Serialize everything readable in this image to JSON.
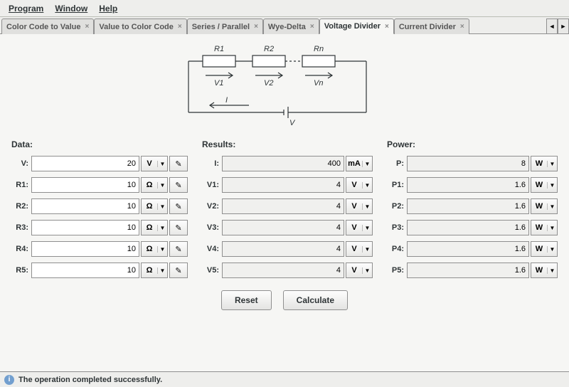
{
  "menu": {
    "program": "Program",
    "window": "Window",
    "help": "Help"
  },
  "tabs": {
    "items": [
      {
        "label": "Color Code to Value"
      },
      {
        "label": "Value to Color Code"
      },
      {
        "label": "Series / Parallel"
      },
      {
        "label": "Wye-Delta"
      },
      {
        "label": "Voltage Divider"
      },
      {
        "label": "Current Divider"
      }
    ],
    "activeIndex": 4
  },
  "diagram": {
    "r1": "R1",
    "r2": "R2",
    "rn": "Rn",
    "v1": "V1",
    "v2": "V2",
    "vn": "Vn",
    "i": "I",
    "v": "V"
  },
  "headers": {
    "data": "Data:",
    "results": "Results:",
    "power": "Power:"
  },
  "data": {
    "rows": [
      {
        "label": "V:",
        "value": "20",
        "unit": "V"
      },
      {
        "label": "R1:",
        "value": "10",
        "unit": "Ω"
      },
      {
        "label": "R2:",
        "value": "10",
        "unit": "Ω"
      },
      {
        "label": "R3:",
        "value": "10",
        "unit": "Ω"
      },
      {
        "label": "R4:",
        "value": "10",
        "unit": "Ω"
      },
      {
        "label": "R5:",
        "value": "10",
        "unit": "Ω"
      }
    ]
  },
  "results": {
    "rows": [
      {
        "label": "I:",
        "value": "400",
        "unit": "mA"
      },
      {
        "label": "V1:",
        "value": "4",
        "unit": "V"
      },
      {
        "label": "V2:",
        "value": "4",
        "unit": "V"
      },
      {
        "label": "V3:",
        "value": "4",
        "unit": "V"
      },
      {
        "label": "V4:",
        "value": "4",
        "unit": "V"
      },
      {
        "label": "V5:",
        "value": "4",
        "unit": "V"
      }
    ]
  },
  "power": {
    "rows": [
      {
        "label": "P:",
        "value": "8",
        "unit": "W"
      },
      {
        "label": "P1:",
        "value": "1.6",
        "unit": "W"
      },
      {
        "label": "P2:",
        "value": "1.6",
        "unit": "W"
      },
      {
        "label": "P3:",
        "value": "1.6",
        "unit": "W"
      },
      {
        "label": "P4:",
        "value": "1.6",
        "unit": "W"
      },
      {
        "label": "P5:",
        "value": "1.6",
        "unit": "W"
      }
    ]
  },
  "buttons": {
    "reset": "Reset",
    "calculate": "Calculate"
  },
  "status": {
    "text": "The operation completed successfully."
  }
}
